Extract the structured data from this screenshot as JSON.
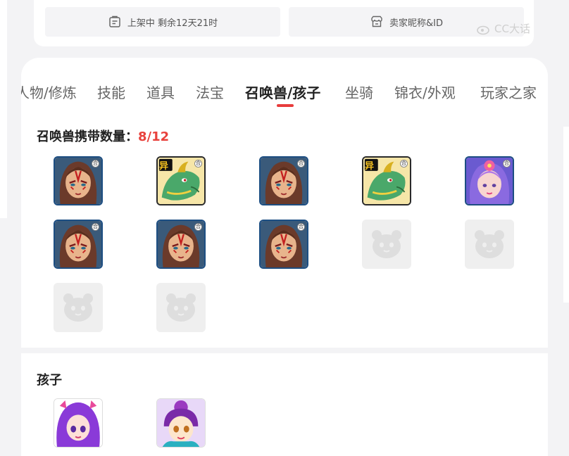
{
  "listing": {
    "status_label": "上架中 剩余12天21时",
    "seller_label": "卖家昵称&ID"
  },
  "watermark": "CC大话",
  "tabs": [
    {
      "label": "人物/修炼",
      "active": false
    },
    {
      "label": "技能",
      "active": false
    },
    {
      "label": "道具",
      "active": false
    },
    {
      "label": "法宝",
      "active": false
    },
    {
      "label": "召唤兽/孩子",
      "active": true
    },
    {
      "label": "坐骑",
      "active": false
    },
    {
      "label": "锦衣/外观",
      "active": false
    },
    {
      "label": "玩家之家",
      "active": false
    }
  ],
  "summons": {
    "title": "召唤兽携带数量：",
    "count": "8/12",
    "lock_glyph": "合",
    "badge_text": "异",
    "slots": [
      {
        "type": "warrior"
      },
      {
        "type": "dragon"
      },
      {
        "type": "warrior"
      },
      {
        "type": "dragon"
      },
      {
        "type": "fairy"
      },
      {
        "type": "warrior"
      },
      {
        "type": "warrior"
      },
      {
        "type": "warrior"
      },
      {
        "type": "empty"
      },
      {
        "type": "empty"
      },
      {
        "type": "empty"
      },
      {
        "type": "empty"
      }
    ]
  },
  "children": {
    "title": "孩子",
    "items": [
      {
        "type": "purple-girl"
      },
      {
        "type": "pink-girl"
      }
    ]
  },
  "colors": {
    "accent": "#e83c3c",
    "count": "#e8413c",
    "slot_border": "#1d4e82"
  }
}
